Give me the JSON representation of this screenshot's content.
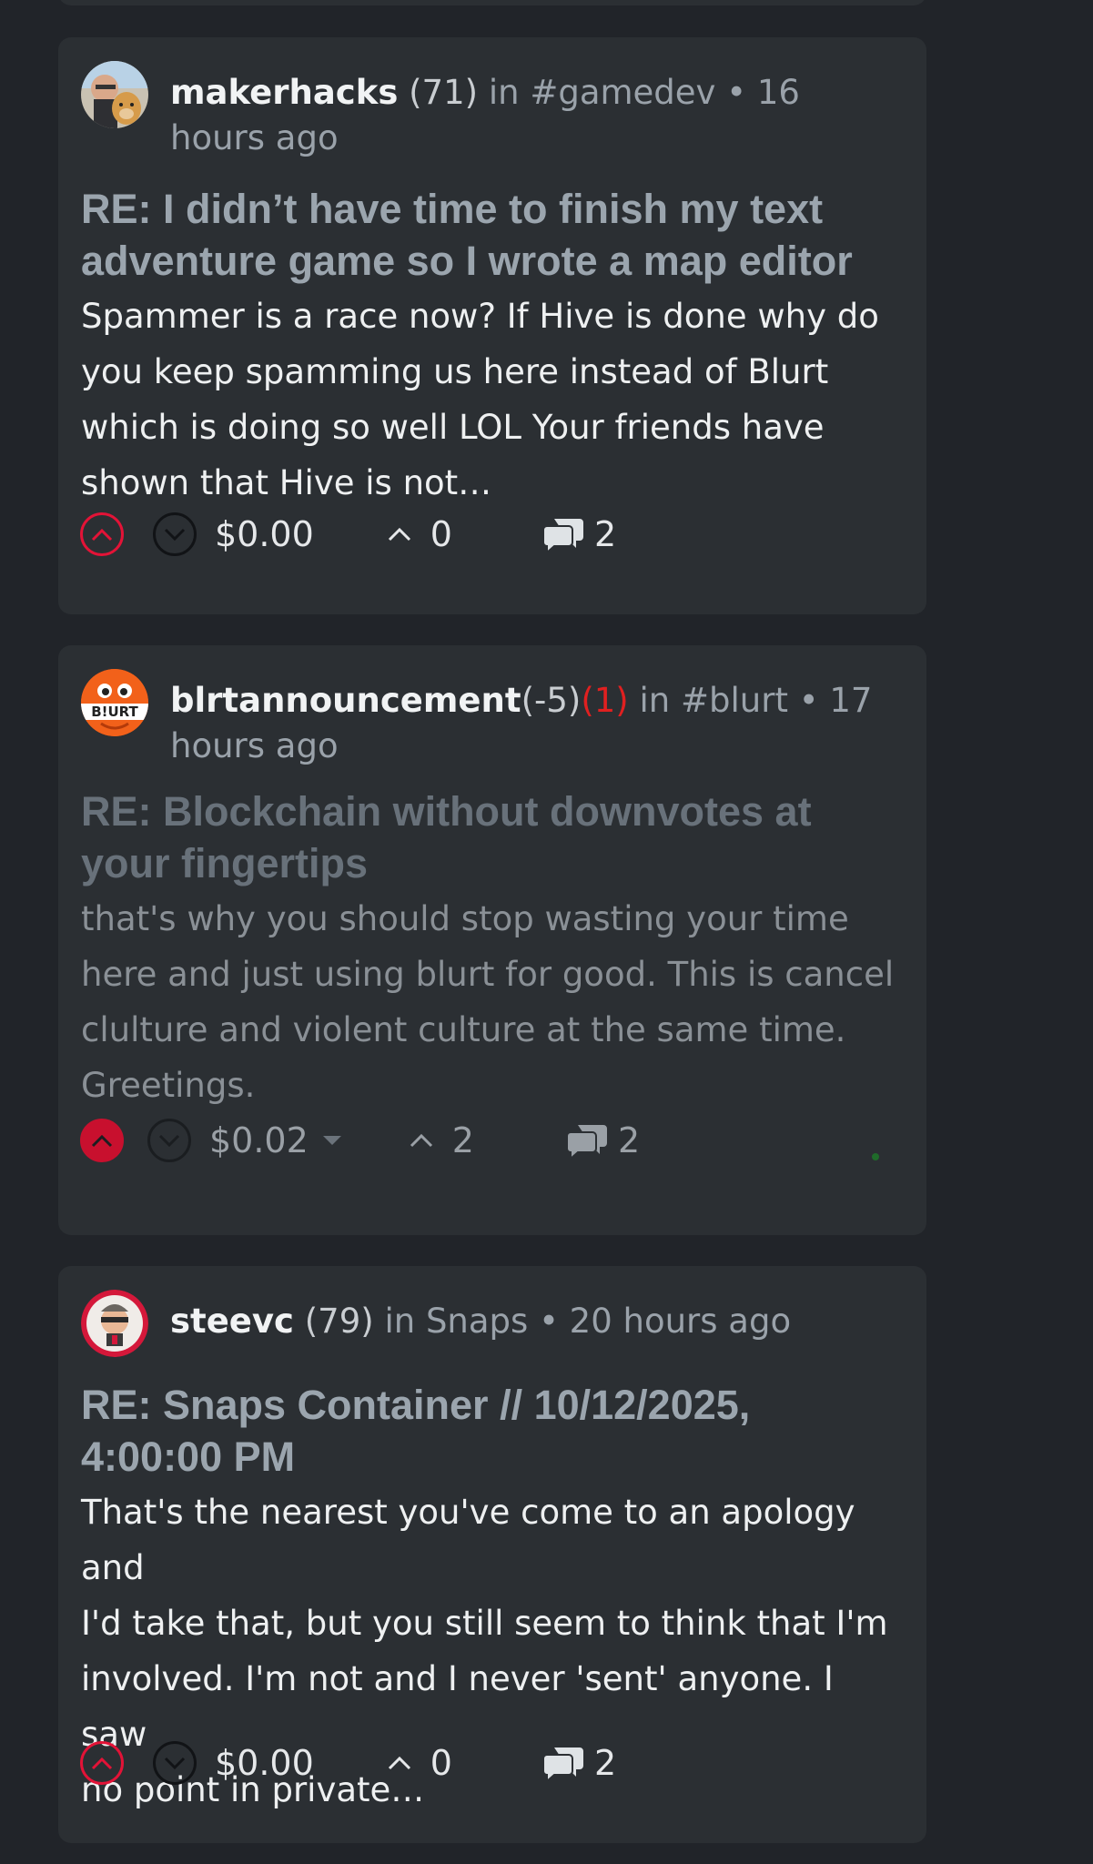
{
  "posts": [
    {
      "author": "makerhacks",
      "reputation": "(71)",
      "community_prefix": "in",
      "community": "#gamedev",
      "separator": "•",
      "time": "16 hours ago",
      "title_line1": "RE: I didn’t have time to finish my text",
      "title_line2": "adventure game so I wrote a map editor",
      "body_lines": [
        "Spammer is a race now? If Hive is done why do",
        "you keep spamming us here instead of Blurt",
        "which is doing so well LOL Your friends have",
        "shown that Hive is not…"
      ],
      "payout": "$0.00",
      "votes": "0",
      "replies": "2"
    },
    {
      "author": "blrtannouncement",
      "reputation": "(-5)",
      "mute_count": "(1)",
      "community_prefix": "in",
      "community": "#blurt",
      "separator": "•",
      "time_line1": "17",
      "time_line2": "hours ago",
      "avatar_text": "B!URT",
      "title_line1": "RE: Blockchain without downvotes at",
      "title_line2": "your fingertips",
      "body_lines": [
        "that's why you should stop wasting your time",
        "here and just using blurt for good. This is cancel",
        "clulture and violent culture at the same time.",
        "Greetings."
      ],
      "payout": "$0.02",
      "votes": "2",
      "replies": "2"
    },
    {
      "author": "steevc",
      "reputation": "(79)",
      "community_prefix": "in",
      "community": "Snaps",
      "separator": "•",
      "time": "20 hours ago",
      "title_line1": "RE: Snaps Container // 10/12/2025,",
      "title_line2": "4:00:00 PM",
      "body_lines": [
        "That's the nearest you've come to an apology and",
        "I'd take that, but you still seem to think that I'm",
        "involved. I'm not and I never 'sent' anyone. I saw",
        "no point in private…"
      ],
      "payout": "$0.00",
      "votes": "0",
      "replies": "2"
    }
  ],
  "colors": {
    "background": "#212429",
    "card": "#2b2f33",
    "upvote_red": "#e31337",
    "muted_red": "#e02020"
  },
  "icons": {
    "upvote": "chevron-up-circle",
    "downvote": "chevron-down-circle",
    "votes": "caret-up",
    "replies": "chat-bubbles"
  }
}
